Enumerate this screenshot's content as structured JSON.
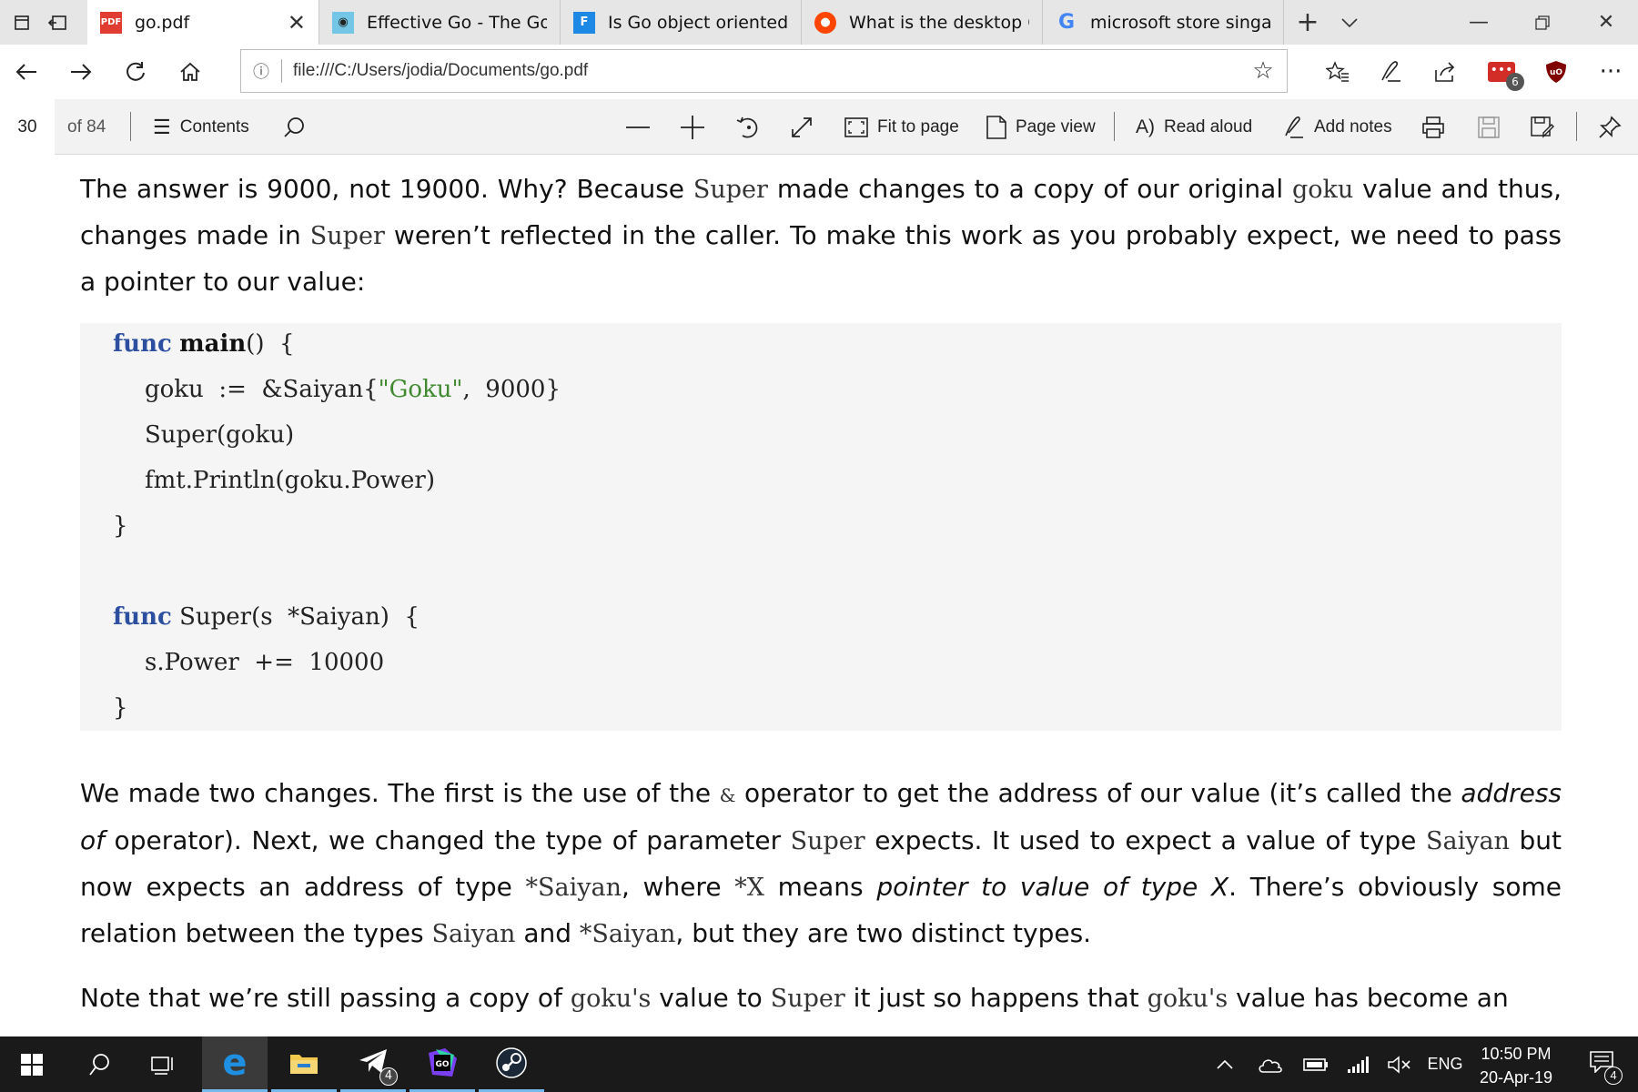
{
  "tabs": [
    {
      "label": "go.pdf",
      "icon": "pdf-icon",
      "active": true
    },
    {
      "label": "Effective Go - The Go P",
      "icon": "gopher-icon"
    },
    {
      "label": "Is Go object oriented?",
      "icon": "f-icon"
    },
    {
      "label": "What is the desktop GL",
      "icon": "reddit-icon"
    },
    {
      "label": "microsoft store singapc",
      "icon": "google-icon"
    }
  ],
  "address": {
    "url": "file:///C:/Users/jodia/Documents/go.pdf"
  },
  "extensions": {
    "badge_count": "6"
  },
  "pdf_toolbar": {
    "page_current": "30",
    "page_total": "of 84",
    "contents": "Contents",
    "fit_to_page": "Fit to page",
    "page_view": "Page view",
    "read_aloud": "Read aloud",
    "add_notes": "Add notes"
  },
  "document": {
    "p1": {
      "t1": "The answer is 9000, not 19000.  Why?  Because ",
      "c1": "Super",
      "t2": " made changes to a copy of our original ",
      "c2": "goku",
      "t3": " value and thus, changes made in ",
      "c3": "Super",
      "t4": " weren’t reflected in the caller.  To make this work as you probably expect, we need to pass a pointer to our value:"
    },
    "code": {
      "l1_kw": "func",
      "l1_name": "main",
      "l1_rest": "()  {",
      "l2_a": "goku  :=  &Saiyan{",
      "l2_str": "\"Goku\"",
      "l2_b": ",  9000}",
      "l3": "Super(goku)",
      "l4": "fmt.Println(goku.Power)",
      "l5": "}",
      "l6_kw": "func",
      "l6_rest": "Super(s  *Saiyan)  {",
      "l7": "s.Power  +=  10000",
      "l8": "}"
    },
    "p2": {
      "t1": "We made two changes.  The first is the use of the ",
      "c1": "&",
      "t2": " operator to get the address of our value (it’s called the ",
      "i1": "address of",
      "t3": " operator).  Next, we changed the type of parameter ",
      "c2": "Super",
      "t4": " expects.  It used to expect a value of type ",
      "c3": "Saiyan",
      "t5": " but now expects an address of type ",
      "c4": "*Saiyan",
      "t6": ", where ",
      "c5": "*X",
      "t7": " means ",
      "i2": "pointer to value of type X",
      "t8": ".  There’s obviously some relation between the types ",
      "c6": "Saiyan",
      "t9": " and ",
      "c7": "*Saiyan",
      "t10": ", but they are two distinct types."
    },
    "p3": {
      "t1": "Note that we’re still passing a copy of ",
      "c1": "goku's",
      "t2": " value to ",
      "c2": "Super",
      "t3": " it just so happens that ",
      "c3": "goku's",
      "t4": " value has become an"
    }
  },
  "taskbar": {
    "telegram_badge": "4",
    "language": "ENG",
    "time": "10:50 PM",
    "date": "20-Apr-19",
    "notification_badge": "4"
  },
  "colors": {
    "keyword": "#2c4fa0",
    "string": "#3f8a2f",
    "taskbar": "#1a1a1a",
    "accent": "#0078d7"
  }
}
